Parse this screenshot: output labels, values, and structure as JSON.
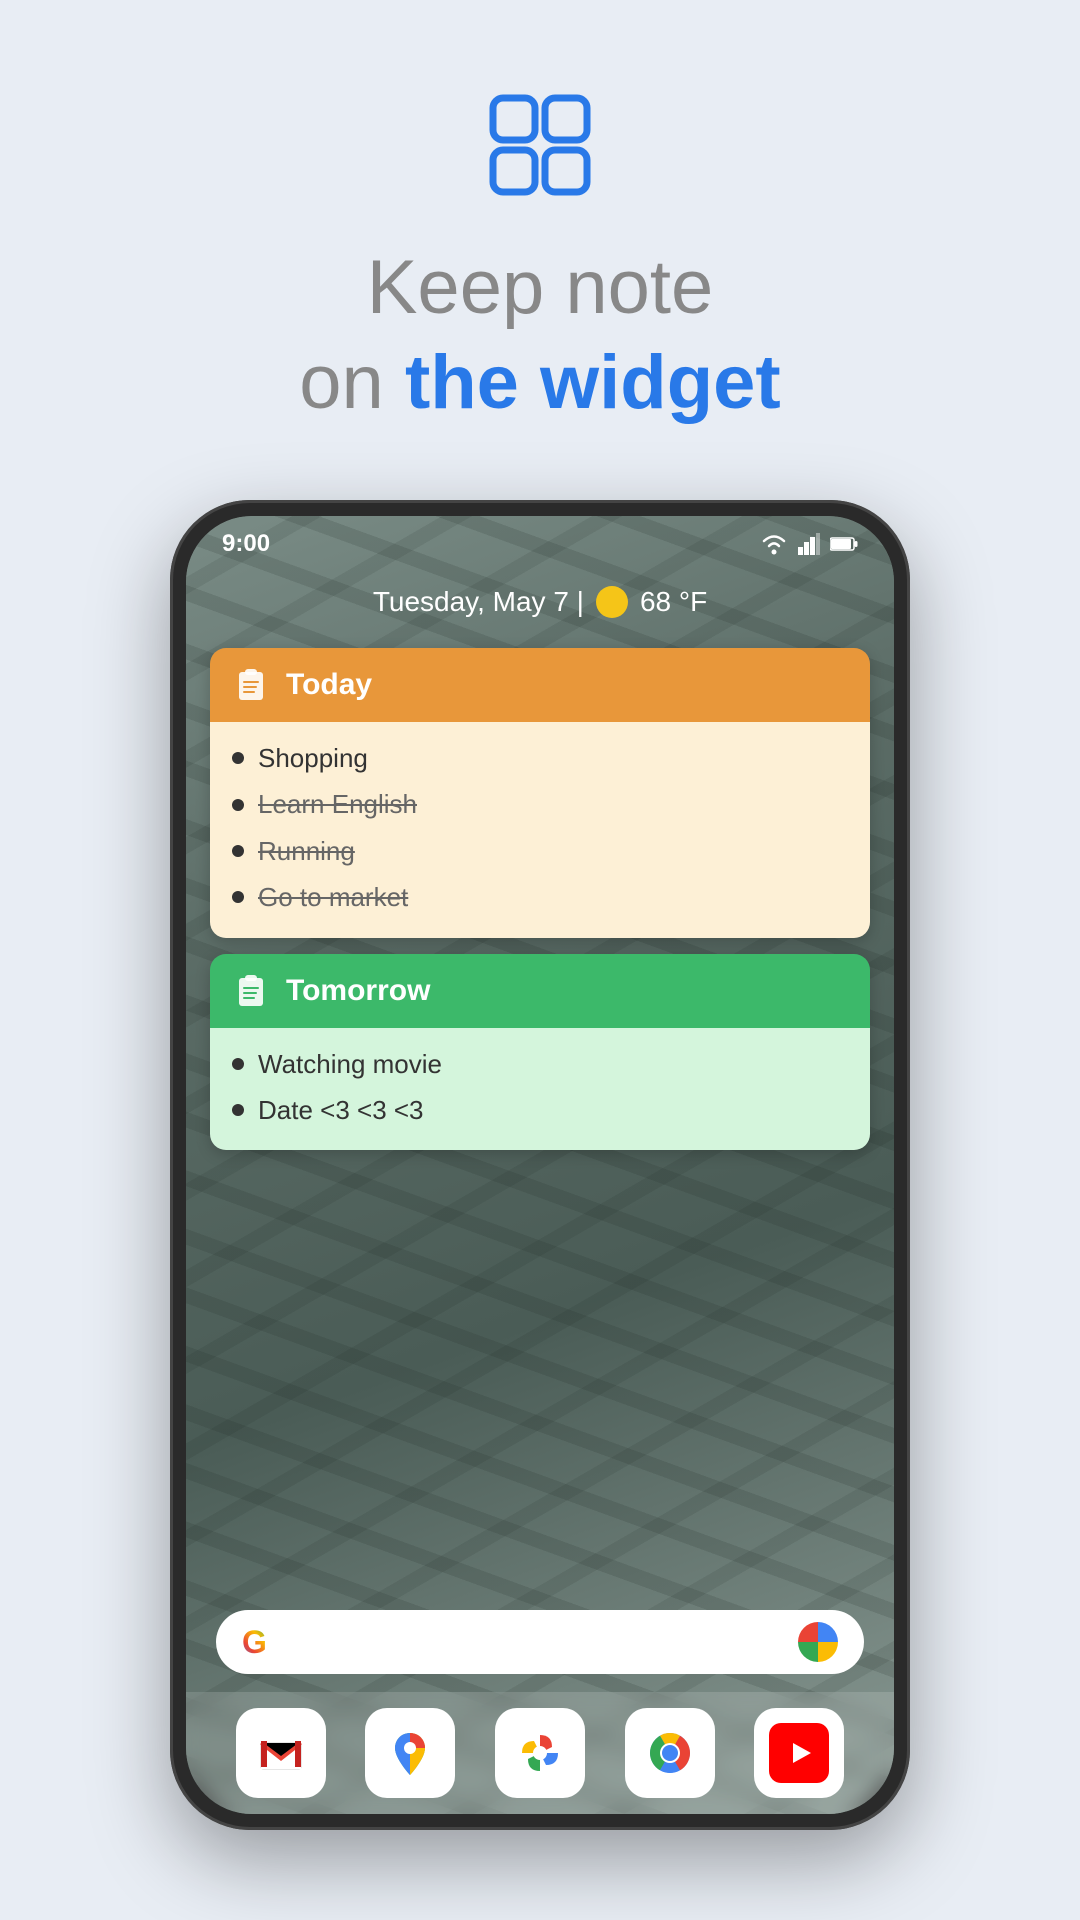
{
  "page": {
    "background_color": "#e8edf4"
  },
  "header": {
    "icon_label": "widget-app-icon",
    "headline_line1": "Keep note",
    "headline_line2_prefix": "on ",
    "headline_line2_highlight": "the widget"
  },
  "phone": {
    "status_bar": {
      "time": "9:00",
      "wifi_icon": "wifi",
      "signal_icon": "signal",
      "battery_icon": "battery"
    },
    "date_weather": {
      "text": "Tuesday, May 7 |",
      "temperature": "68 °F"
    },
    "widget_today": {
      "header_title": "Today",
      "items": [
        {
          "text": "Shopping",
          "strikethrough": false
        },
        {
          "text": "Learn English",
          "strikethrough": true
        },
        {
          "text": "Running",
          "strikethrough": true
        },
        {
          "text": "Go to market",
          "strikethrough": true
        }
      ]
    },
    "widget_tomorrow": {
      "header_title": "Tomorrow",
      "items": [
        {
          "text": "Watching movie",
          "strikethrough": false
        },
        {
          "text": "Date <3 <3 <3",
          "strikethrough": false
        }
      ]
    },
    "dock": {
      "apps": [
        "Gmail",
        "Maps",
        "Photos",
        "Chrome",
        "YouTube"
      ]
    },
    "search_bar": {
      "g_label": "G",
      "assistant_label": "assistant"
    }
  },
  "colors": {
    "blue_accent": "#2979e8",
    "orange_header": "#e8973a",
    "orange_body": "#fdf0d6",
    "green_header": "#3cb96a",
    "green_body": "#d4f5dc"
  }
}
